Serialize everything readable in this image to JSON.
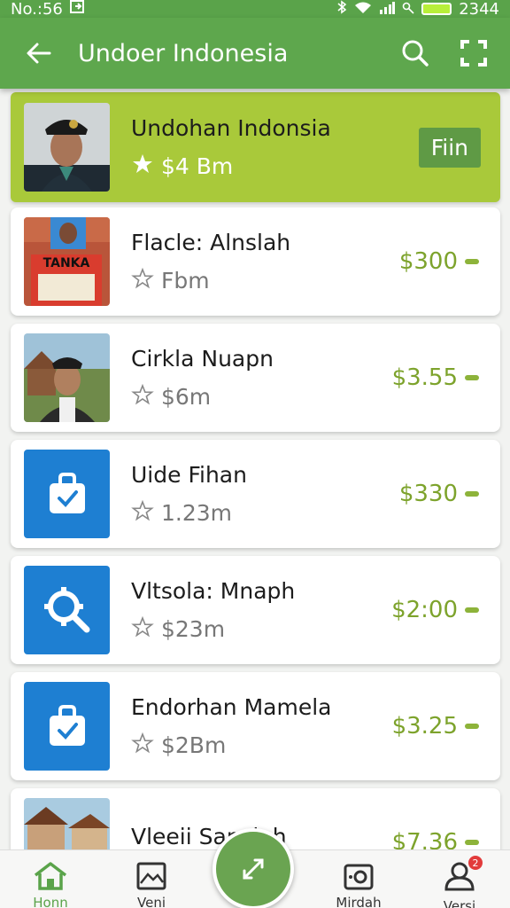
{
  "status_bar": {
    "time": "No.:56",
    "clock": "2344"
  },
  "app_bar": {
    "title": "Undoer Indonesia"
  },
  "featured": {
    "name": "Undohan Indonsia",
    "sub": "$4 Bm",
    "action_label": "Fiin"
  },
  "items": [
    {
      "name": "Flacle: Alnslah",
      "sub": "Fbm",
      "price": "$300"
    },
    {
      "name": "Cirkla Nuapn",
      "sub": "$6m",
      "price": "$3.55"
    },
    {
      "name": "Uide Fihan",
      "sub": "1.23m",
      "price": "$330"
    },
    {
      "name": "Vltsola: Mnaph",
      "sub": "$23m",
      "price": "$2:00"
    },
    {
      "name": "Endorhan Mamela",
      "sub": "$2Bm",
      "price": "$3.25"
    },
    {
      "name": "Vleeii Sanclah",
      "sub": "",
      "price": "$7.36"
    }
  ],
  "thumb_text": {
    "poster": "TANKA"
  },
  "bottom_nav": [
    {
      "label": "Honn",
      "icon": "home-icon"
    },
    {
      "label": "Veni",
      "icon": "image-icon"
    },
    {
      "label": "Mirdah",
      "icon": "camera-icon"
    },
    {
      "label": "Versi",
      "icon": "user-icon",
      "badge": "2"
    }
  ],
  "colors": {
    "primary": "#5ea74d",
    "featured": "#a9c93a",
    "price": "#7da32c",
    "tile": "#1e7fd2"
  }
}
